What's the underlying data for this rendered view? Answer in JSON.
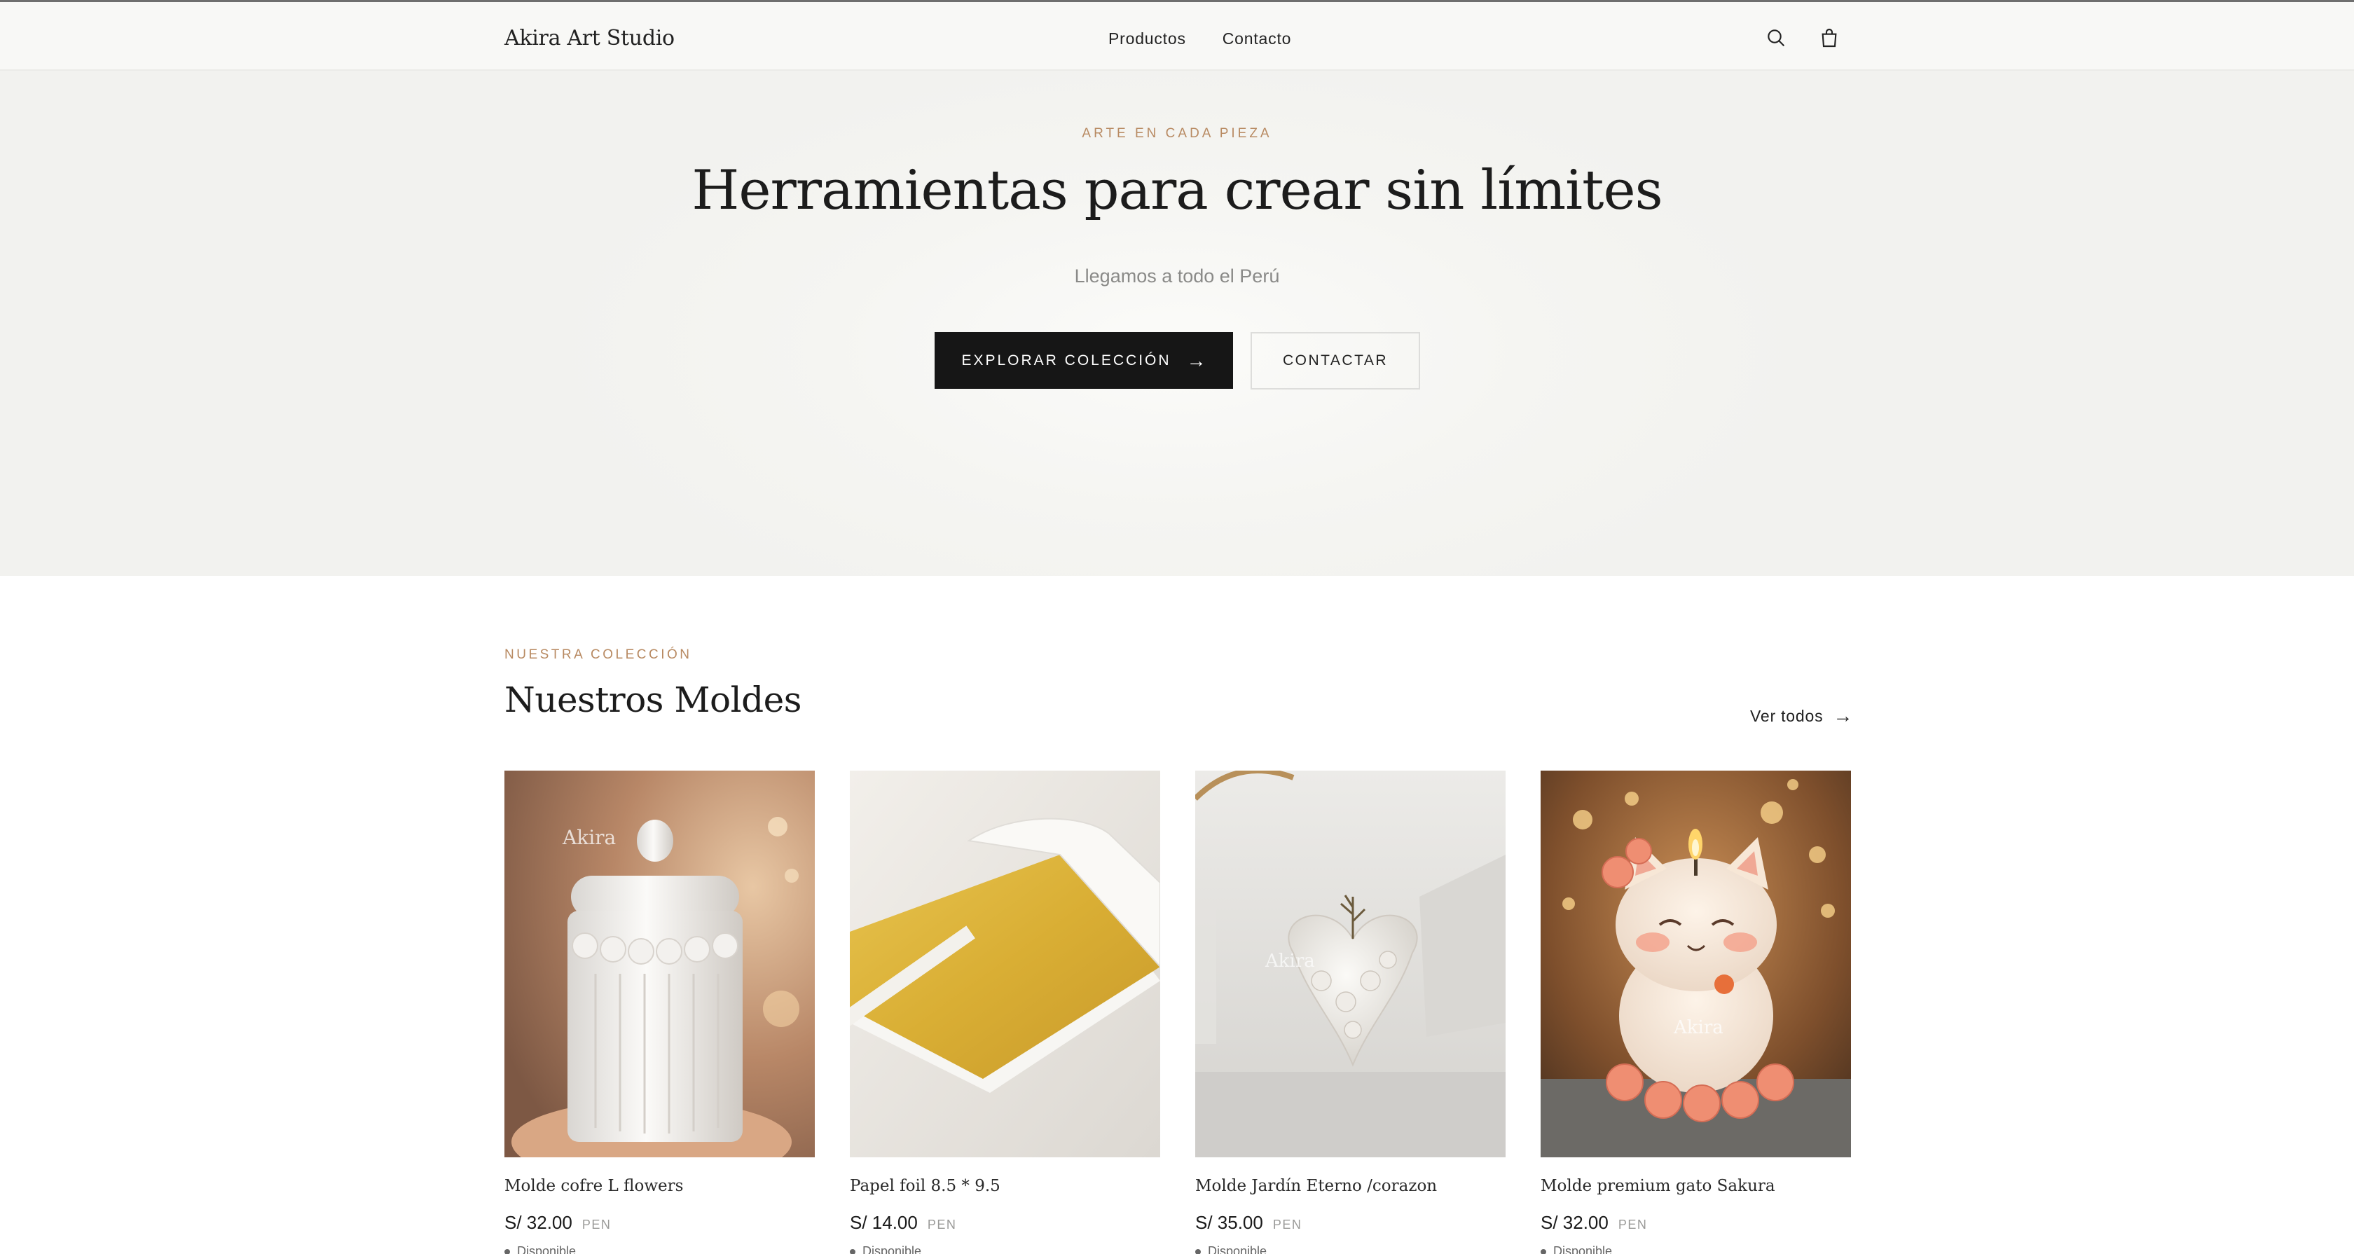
{
  "header": {
    "brand": "Akira Art Studio",
    "nav": [
      {
        "label": "Productos"
      },
      {
        "label": "Contacto"
      }
    ],
    "icons": [
      "search-icon",
      "shopping-bag-icon"
    ]
  },
  "hero": {
    "eyebrow": "ARTE EN CADA PIEZA",
    "title": "Herramientas para crear sin límites",
    "subtitle": "Llegamos a todo el Perú",
    "primary_button": "EXPLORAR COLECCIÓN",
    "secondary_button": "CONTACTAR"
  },
  "collection": {
    "eyebrow": "NUESTRA COLECCIÓN",
    "title": "Nuestros Moldes",
    "see_all": "Ver todos",
    "products": [
      {
        "name": "Molde cofre L flowers",
        "price": "S/ 32.00",
        "currency": "PEN",
        "watermark": "Akira",
        "stock": "Disponible"
      },
      {
        "name": "Papel foil 8.5 * 9.5",
        "price": "S/ 14.00",
        "currency": "PEN",
        "stock": "Disponible"
      },
      {
        "name": "Molde Jardín Eterno /corazon",
        "price": "S/ 35.00",
        "currency": "PEN",
        "watermark": "Akira",
        "stock": "Disponible"
      },
      {
        "name": "Molde premium gato Sakura",
        "price": "S/ 32.00",
        "currency": "PEN",
        "watermark": "Akira",
        "stock": "Disponible"
      }
    ]
  },
  "colors": {
    "accent": "#b88a62",
    "primary_button": "#161616",
    "header_bg": "#f8f8f6",
    "hero_bg": "#f3f3f0"
  }
}
